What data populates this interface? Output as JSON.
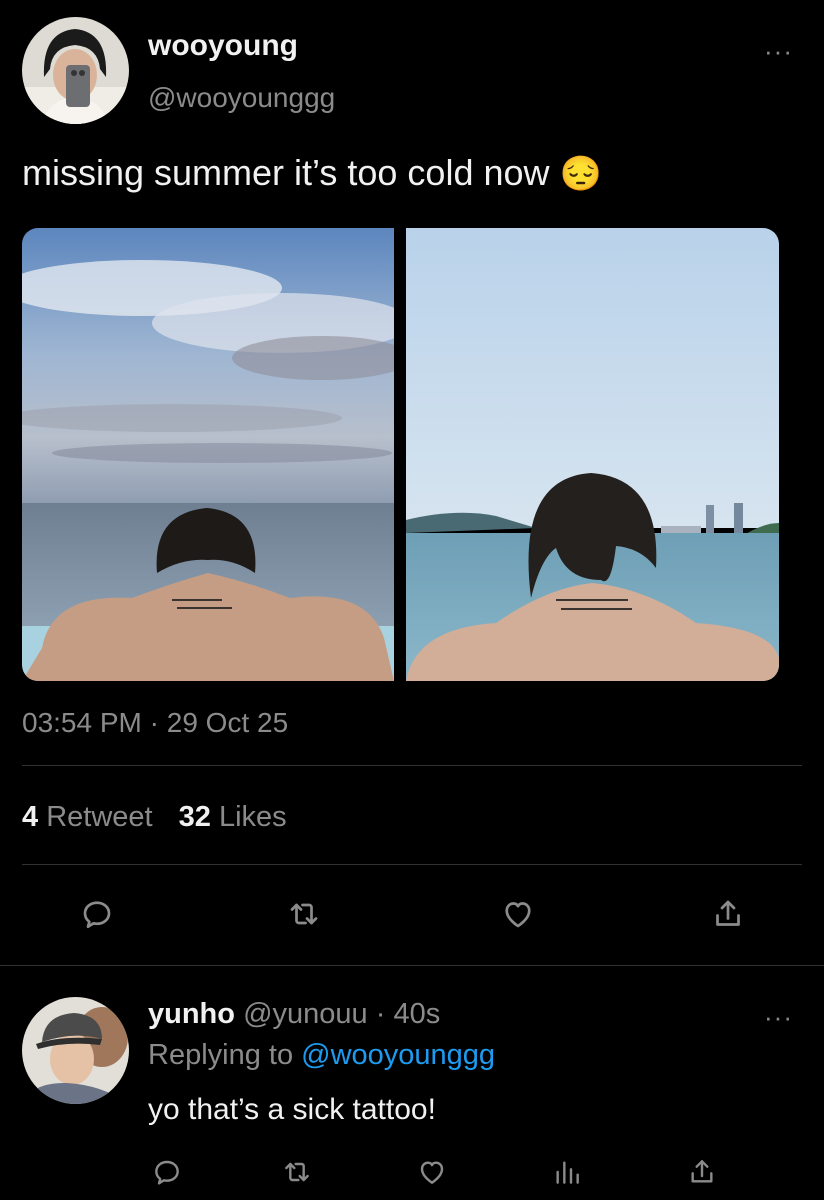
{
  "tweet": {
    "author_name": "wooyoung",
    "author_handle": "@wooyounggg",
    "text": "missing summer it’s too cold now",
    "emoji": "😔",
    "time": "03:54 PM",
    "date_sep": "·",
    "date": "29 Oct 25",
    "retweet_count": "4",
    "retweet_label": "Retweet",
    "like_count": "32",
    "like_label": "Likes",
    "more": "···"
  },
  "reply": {
    "author_name": "yunho",
    "author_handle": "@yunouu",
    "sep": "·",
    "age": "40s",
    "replying_prefix": "Replying to",
    "replying_to": "@wooyounggg",
    "text": "yo that’s a sick tattoo!",
    "more": "···"
  },
  "colors": {
    "background": "#000000",
    "text": "#e7e9ea",
    "muted": "#8b8b8b",
    "link": "#1d9bf0",
    "divider": "#2f3336"
  },
  "icons": [
    "comment-icon",
    "retweet-icon",
    "like-icon",
    "share-icon",
    "analytics-icon",
    "more-icon"
  ]
}
